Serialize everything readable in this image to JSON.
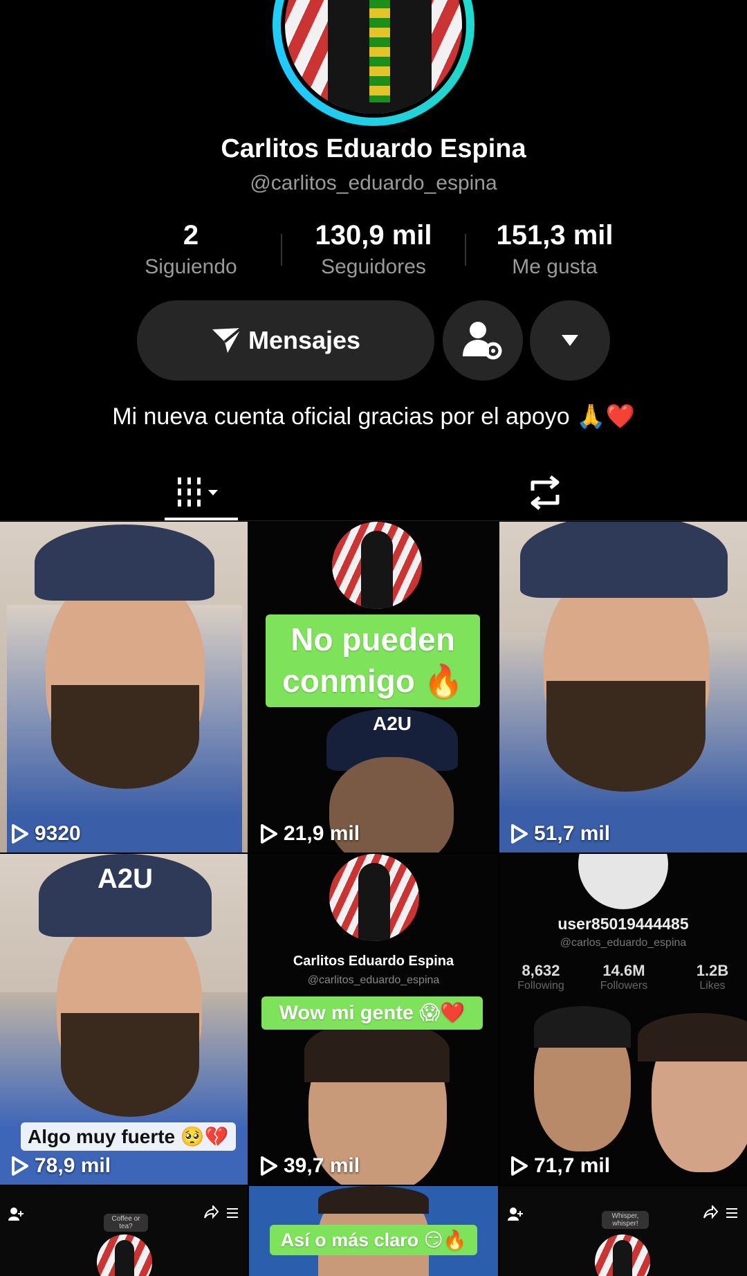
{
  "profile": {
    "name": "Carlitos Eduardo Espina",
    "handle": "@carlitos_eduardo_espina",
    "stats": [
      {
        "value": "2",
        "label": "Siguiendo"
      },
      {
        "value": "130,9 mil",
        "label": "Seguidores"
      },
      {
        "value": "151,3 mil",
        "label": "Me gusta"
      }
    ],
    "message_button": "Mensajes",
    "bio": "Mi nueva cuenta oficial gracias por el apoyo 🙏❤️"
  },
  "tabs": {
    "videos_icon": "grid-icon",
    "reposts_icon": "repost-icon"
  },
  "videos": [
    {
      "views": "9320"
    },
    {
      "views": "21,9 mil",
      "caption": "No pueden conmigo 🔥",
      "hat_text": "A2U"
    },
    {
      "views": "51,7 mil"
    },
    {
      "views": "78,9 mil",
      "caption": "Algo muy fuerte 🥺💔",
      "hat_text": "A2U"
    },
    {
      "views": "39,7 mil",
      "inner_name": "Carlitos Eduardo Espina",
      "inner_handle": "@carlitos_eduardo_espina",
      "caption": "Wow mi gente 😱❤️"
    },
    {
      "views": "71,7 mil",
      "inner_user": "user85019444485",
      "inner_handle": "@carlos_eduardo_espina",
      "inner_stats": [
        {
          "value": "8,632",
          "label": "Following"
        },
        {
          "value": "14.6M",
          "label": "Followers"
        },
        {
          "value": "1.2B",
          "label": "Likes"
        }
      ]
    },
    {
      "bubble": "Coffee or tea?"
    },
    {
      "caption": "Así o más claro 😏🔥"
    },
    {
      "bubble": "Whisper, whisper!"
    }
  ]
}
